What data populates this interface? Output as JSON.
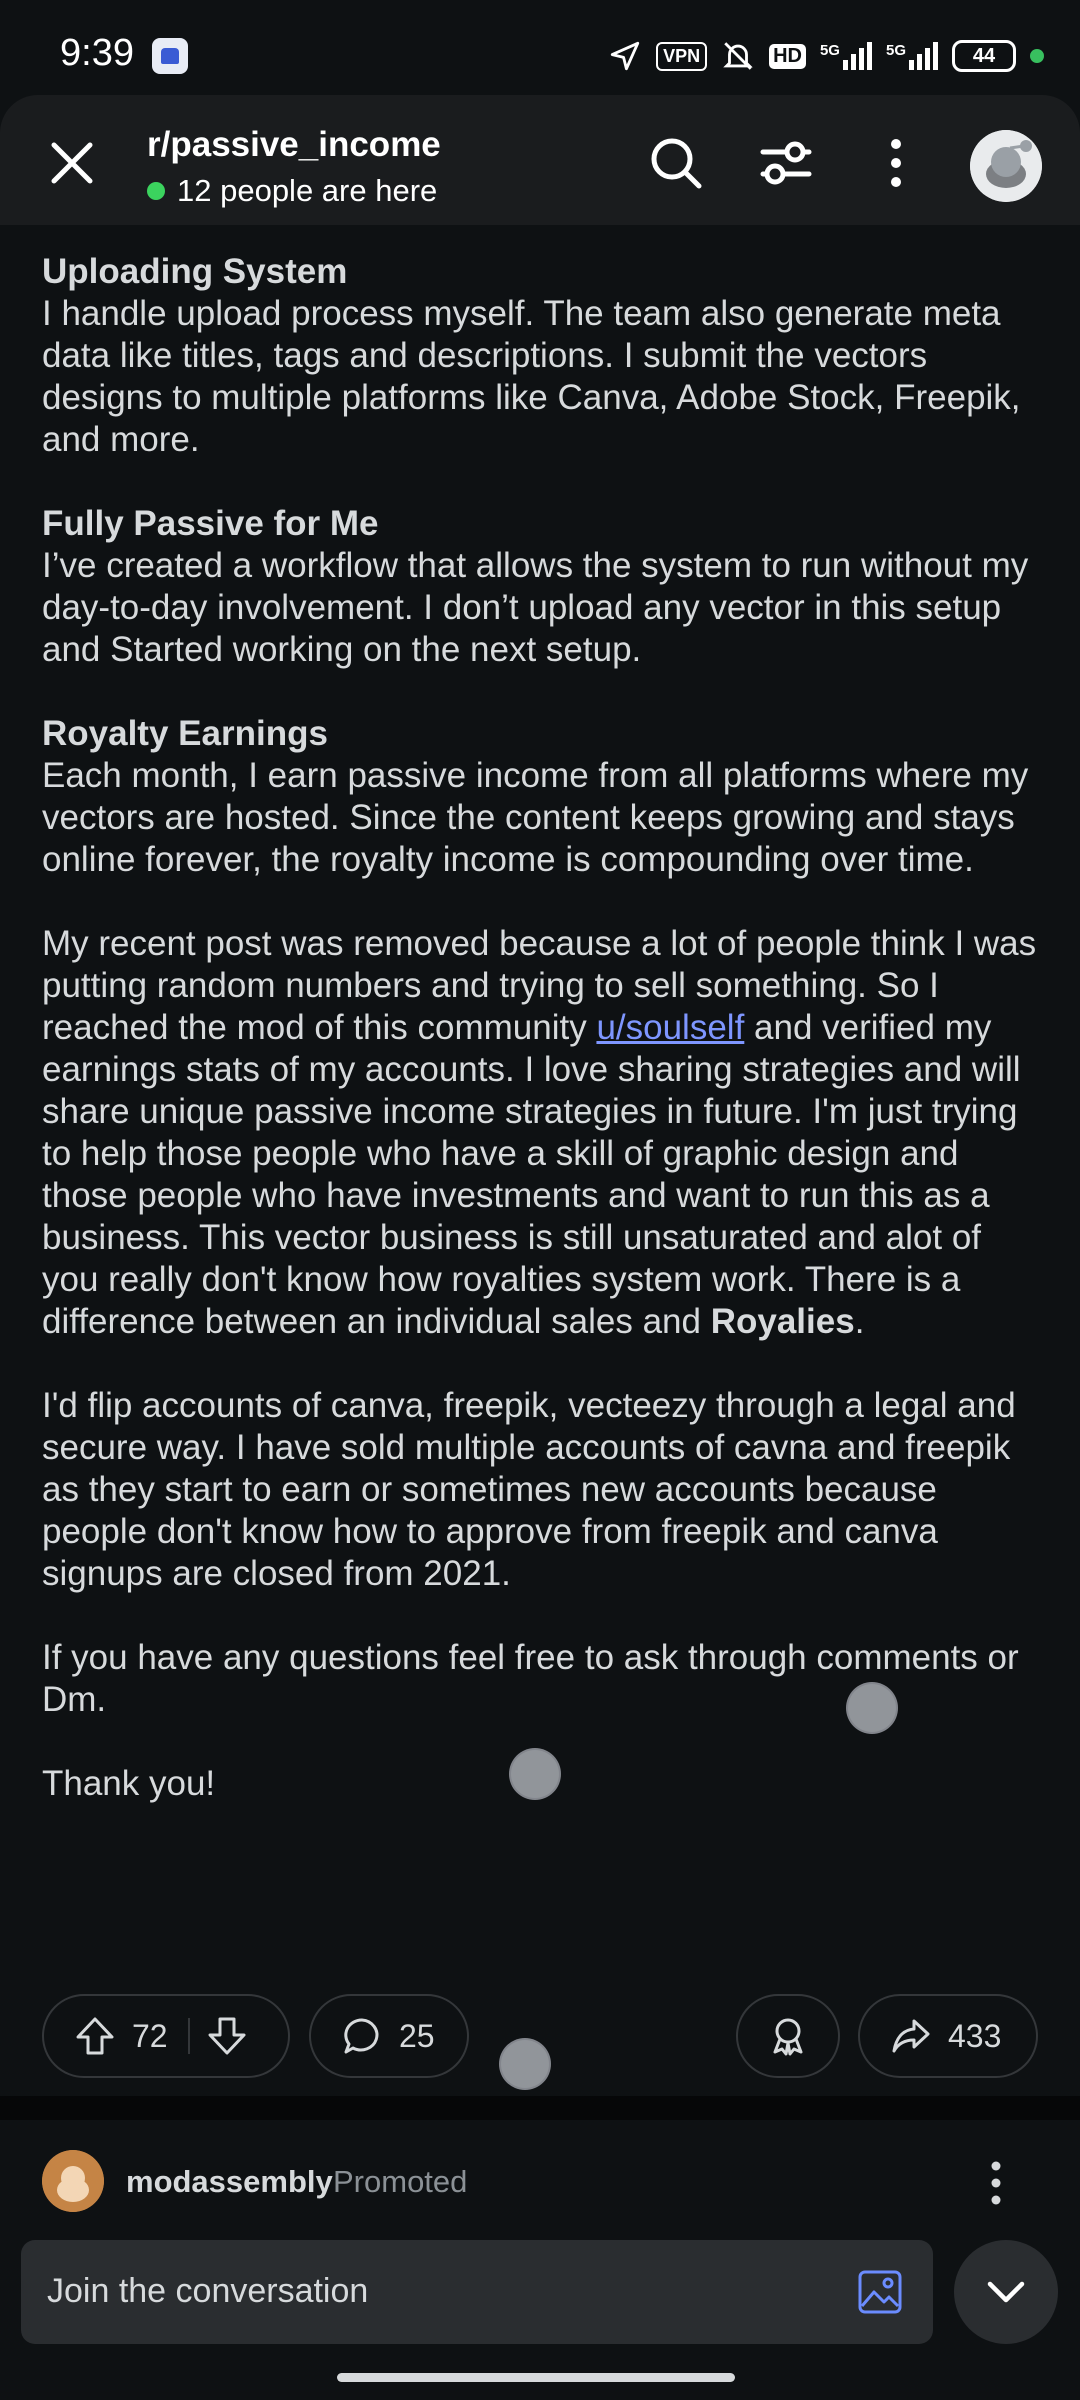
{
  "status_bar": {
    "time": "9:39",
    "vpn": "VPN",
    "hd": "HD",
    "net1": "5G",
    "net2": "5G",
    "battery": "44"
  },
  "header": {
    "subreddit": "r/passive_income",
    "online_text": "12 people are here"
  },
  "post": {
    "sections": [
      {
        "heading": "Uploading System",
        "body": "I handle upload process myself. The team also generate meta data like titles, tags and descriptions. I submit the vectors designs to multiple platforms like Canva, Adobe Stock, Freepik, and more."
      },
      {
        "heading": "Fully Passive for Me",
        "body": "I’ve created a workflow that allows the system to run without my day-to-day involvement. I don’t upload any vector in this setup and Started working on the next setup."
      },
      {
        "heading": "Royalty Earnings",
        "body": "Each month, I earn passive income from all platforms where my vectors are hosted. Since the content keeps growing and stays online forever, the royalty income is compounding over time."
      }
    ],
    "para4_before_link": "My recent post was removed because a lot of people think I was putting random numbers and trying to sell something. So I reached the mod of this community ",
    "para4_link": "u/soulself",
    "para4_after_link": " and verified my earnings stats of my accounts. I love sharing strategies and will share unique passive income strategies in future. I'm just trying to help those people who have a skill of graphic design and those people who have investments and want to run this as a business. This vector business is still unsaturated and alot of you really don't know how royalties system work. There is a difference between an individual sales and ",
    "para4_bold": "Royalies",
    "para4_end": ".",
    "para5": "I'd flip accounts of canva, freepik, vecteezy through a legal and secure way. I have sold multiple accounts of cavna and freepik as they start to earn or sometimes new accounts because people don't know how to approve from freepik and canva signups are closed from 2021.",
    "para6": "If you have any questions feel free to ask through comments or Dm.",
    "para7": "Thank you!"
  },
  "actions": {
    "upvotes": "72",
    "comments": "25",
    "shares": "433"
  },
  "promoted": {
    "name": "modassembly",
    "tag": "Promoted"
  },
  "composer": {
    "placeholder": "Join the conversation"
  },
  "colors": {
    "background": "#0e1113",
    "header": "#1a1c1e",
    "link": "#7e96ff",
    "online": "#3bd35e"
  }
}
